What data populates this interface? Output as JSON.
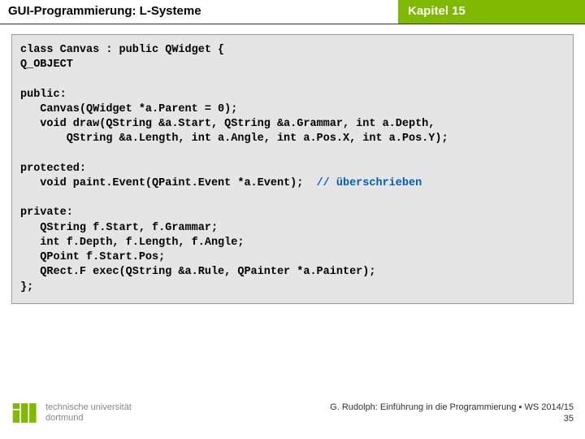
{
  "header": {
    "left": "GUI-Programmierung: L-Systeme",
    "right": "Kapitel 15"
  },
  "code": {
    "line1": "class Canvas : public QWidget {",
    "line2": "Q_OBJECT",
    "line3": "public:",
    "line4": "   Canvas(QWidget *a.Parent = 0);",
    "line5": "   void draw(QString &a.Start, QString &a.Grammar, int a.Depth,",
    "line6": "       QString &a.Length, int a.Angle, int a.Pos.X, int a.Pos.Y);",
    "line7": "protected:",
    "line8a": "   void paint.Event(QPaint.Event *a.Event);  ",
    "line8b": "// überschrieben",
    "line9": "private:",
    "line10": "   QString f.Start, f.Grammar;",
    "line11": "   int f.Depth, f.Length, f.Angle;",
    "line12": "   QPoint f.Start.Pos;",
    "line13": "   QRect.F exec(QString &a.Rule, QPainter *a.Painter);",
    "line14": "};"
  },
  "logo": {
    "line1": "technische universität",
    "line2": "dortmund"
  },
  "footer": {
    "credit": "G. Rudolph: Einführung in die Programmierung ▪ WS 2014/15",
    "page": "35"
  }
}
